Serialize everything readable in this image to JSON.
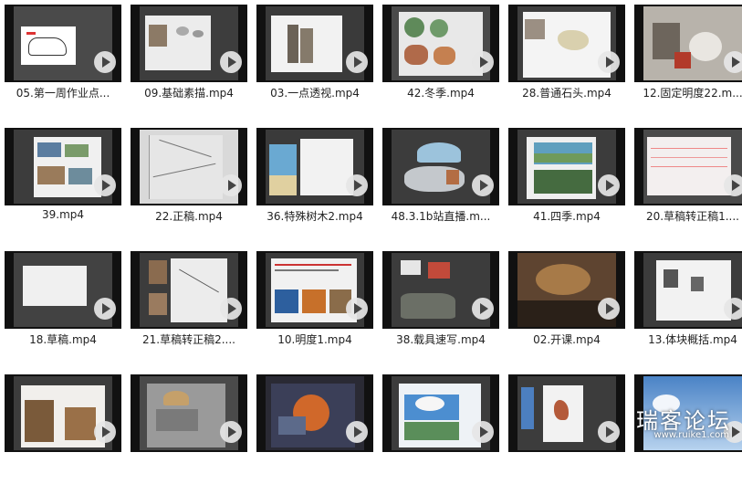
{
  "files": [
    {
      "label": "05.第一周作业点..."
    },
    {
      "label": "09.基础素描.mp4"
    },
    {
      "label": "03.一点透视.mp4"
    },
    {
      "label": "42.冬季.mp4"
    },
    {
      "label": "28.普通石头.mp4"
    },
    {
      "label": "12.固定明度22.m..."
    },
    {
      "label": "39.mp4"
    },
    {
      "label": "22.正稿.mp4"
    },
    {
      "label": "36.特殊树木2.mp4"
    },
    {
      "label": "48.3.1b站直播.m..."
    },
    {
      "label": "41.四季.mp4"
    },
    {
      "label": "20.草稿转正稿1...."
    },
    {
      "label": "18.草稿.mp4"
    },
    {
      "label": "21.草稿转正稿2...."
    },
    {
      "label": "10.明度1.mp4"
    },
    {
      "label": "38.载具速写.mp4"
    },
    {
      "label": "02.开课.mp4"
    },
    {
      "label": "13.体块概括.mp4"
    },
    {
      "label": ""
    },
    {
      "label": ""
    },
    {
      "label": ""
    },
    {
      "label": ""
    },
    {
      "label": ""
    },
    {
      "label": ""
    }
  ],
  "watermark": {
    "text": "瑞客论坛",
    "url": "www.ruike1.com"
  }
}
